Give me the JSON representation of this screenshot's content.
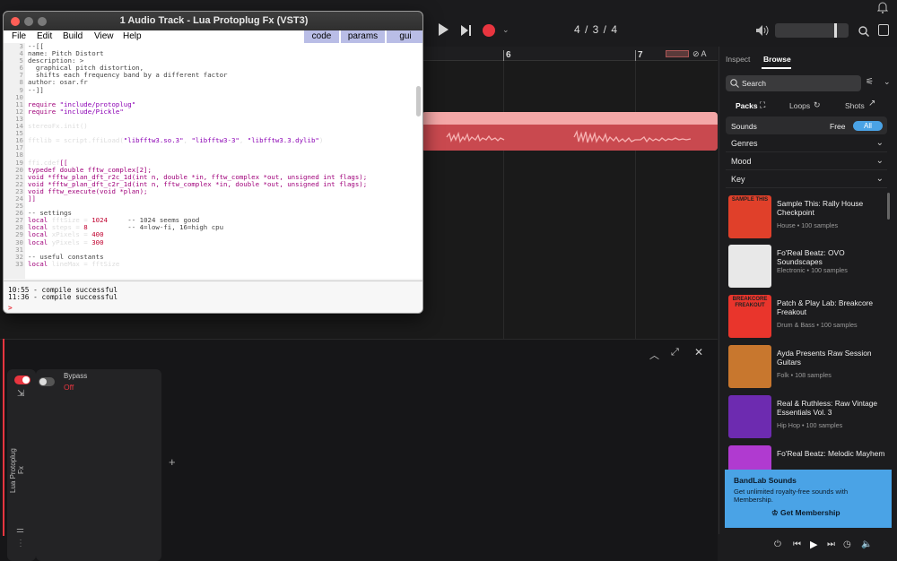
{
  "plugin": {
    "title": "1 Audio Track - Lua Protoplug Fx (VST3)",
    "menu": [
      "File",
      "Edit",
      "Build",
      "View",
      "Help"
    ],
    "tabs": [
      "code",
      "params",
      "gui"
    ],
    "line_numbers": [
      "3",
      "4",
      "5",
      "6",
      "7",
      "8",
      "9",
      "10",
      "11",
      "12",
      "13",
      "14",
      "15",
      "16",
      "17",
      "18",
      "19",
      "20",
      "21",
      "22",
      "23",
      "24",
      "25",
      "26",
      "27",
      "28",
      "29",
      "30",
      "31",
      "32",
      "33"
    ],
    "console": [
      "10:55 - compile successful",
      "11:36 - compile successful",
      ">"
    ]
  },
  "daw": {
    "timecode": "4 / 3 / 4",
    "ruler_marks": [
      "6",
      "7"
    ],
    "toolbar_icons": [
      "play-icon",
      "skip-forward-icon",
      "record-icon",
      "volume-icon",
      "search-icon",
      "panel-icon",
      "bell-icon"
    ]
  },
  "fx": {
    "bypass_label": "Bypass",
    "bypass_state": "Off",
    "plugin_name": "Lua Protoplug Fx",
    "add_label": "+"
  },
  "browser": {
    "tabs": [
      "Inspect",
      "Browse"
    ],
    "search_placeholder": "Search",
    "filters": [
      "Packs",
      "Loops",
      "Shots"
    ],
    "sounds_label": "Sounds",
    "free_label": "Free",
    "all_label": "All",
    "sections": [
      "Genres",
      "Mood",
      "Key"
    ],
    "packs": [
      {
        "title": "Sample This: Rally House Checkpoint",
        "sub": "House • 100 samples",
        "color": "#e0402a",
        "art": "SAMPLE THIS"
      },
      {
        "title": "Fo'Real Beatz: OVO Soundscapes",
        "sub": "Electronic • 100 samples",
        "color": "#e8e8e8",
        "art": ""
      },
      {
        "title": "Patch & Play Lab: Breakcore Freakout",
        "sub": "Drum & Bass • 100 samples",
        "color": "#e9352c",
        "art": "BREAKCORE FREAKOUT"
      },
      {
        "title": "Ayda Presents Raw Session Guitars",
        "sub": "Folk • 108 samples",
        "color": "#c8772e",
        "art": ""
      },
      {
        "title": "Real & Ruthless: Raw Vintage Essentials Vol. 3",
        "sub": "Hip Hop • 100 samples",
        "color": "#6d2bb0",
        "art": ""
      },
      {
        "title": "Fo'Real Beatz: Melodic Mayhem",
        "sub": "",
        "color": "#b03ad0",
        "art": ""
      }
    ],
    "promo": {
      "title": "BandLab Sounds",
      "text": "Get unlimited royalty-free sounds with Membership.",
      "button": "Get Membership"
    }
  },
  "colors": {
    "accent": "#e8353f",
    "browser_accent": "#4aa3e6",
    "clip": "#c9494f"
  }
}
